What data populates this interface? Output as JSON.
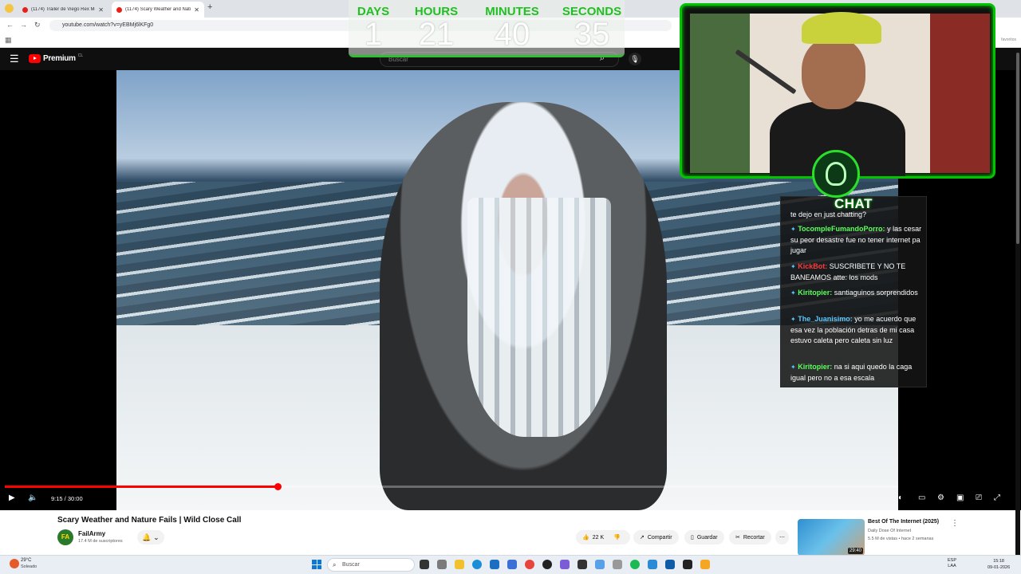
{
  "browser": {
    "tabs": [
      {
        "title": "(1174) Tráiler de Viego Rex Mo..."
      },
      {
        "title": "(1174) Scary Weather and Natu..."
      }
    ],
    "url": "youtube.com/watch?v=yEBMj6lKFg0",
    "bookmarks_label": "favoritos"
  },
  "youtube": {
    "brand": "Premium",
    "country": "CL",
    "search_placeholder": "Buscar"
  },
  "player": {
    "time": "9:15 / 30:00",
    "progress_fraction": 0.305
  },
  "countdown": {
    "labels": [
      "DAYS",
      "HOURS",
      "MINUTES",
      "SECONDS"
    ],
    "values": [
      "1",
      "21",
      "40",
      "35"
    ]
  },
  "chat": {
    "title": "CHAT",
    "messages": [
      {
        "user": "",
        "text": "te dejo en just chatting?",
        "user_color": "#ffffff"
      },
      {
        "user": "TocompleFumandoPorro:",
        "text": " y las cesar su peor desastre fue no tener internet pa jugar",
        "user_color": "#5cff5c"
      },
      {
        "user": "KickBot:",
        "text": " SUSCRIBETE Y NO TE BANEAMOS atte: los mods",
        "user_color": "#ff3b3b"
      },
      {
        "user": "Kiritopier:",
        "text": " santiaguinos sorprendidos",
        "user_color": "#5cff5c"
      },
      {
        "user": "The_Juanisimo:",
        "text": " yo me acuerdo que esa vez la población detras de mi casa estuvo caleta pero caleta sin luz",
        "user_color": "#5cc8ff"
      },
      {
        "user": "Kiritopier:",
        "text": " na si aqui quedo la caga igual pero no a esa escala",
        "user_color": "#5cff5c"
      }
    ]
  },
  "video": {
    "title": "Scary Weather and Nature Fails | Wild Close Call",
    "channel": "FailArmy",
    "subscribers": "17.4 M de suscriptores",
    "likes": "22 K",
    "share_label": "Compartir",
    "save_label": "Guardar",
    "clip_label": "Recortar"
  },
  "suggested": {
    "title": "Best Of The Internet (2025)",
    "channel": "Daily Dose Of Internet",
    "meta": "5.5 M de vistas • hace 2 semanas",
    "duration": "29:40"
  },
  "taskbar": {
    "temperature": "29°C",
    "condition": "Soleado",
    "search_placeholder": "Buscar",
    "lang_top": "ESP",
    "lang_bottom": "LAA",
    "time": "15:18",
    "date": "09-01-2026"
  },
  "colors": {
    "accent_green": "#21c021",
    "youtube_red": "#ff0000"
  }
}
